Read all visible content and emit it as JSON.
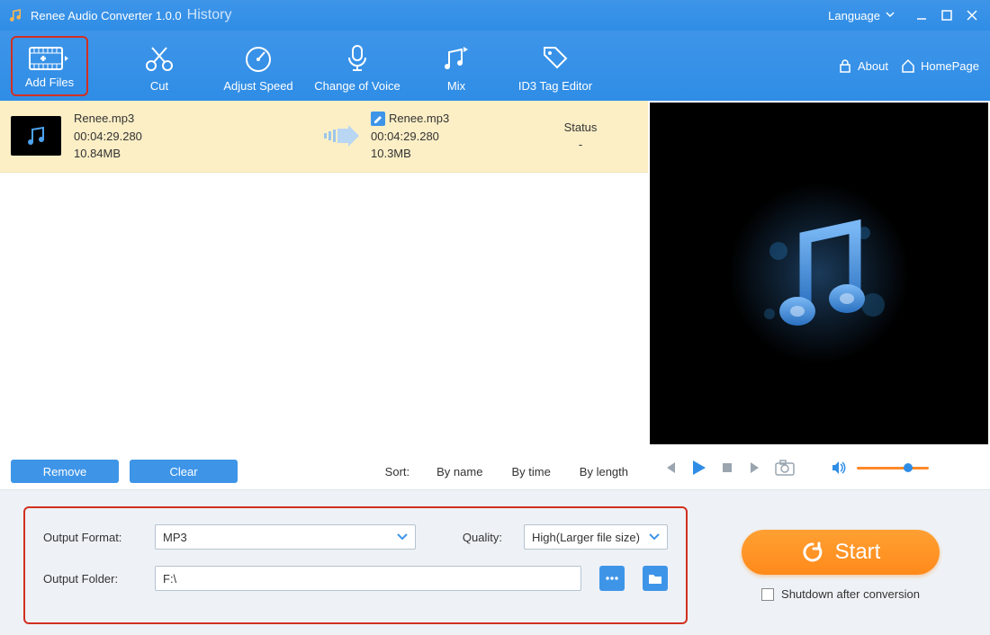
{
  "titlebar": {
    "title": "Renee Audio Converter 1.0.0",
    "history": "History",
    "language": "Language"
  },
  "toolbar": {
    "add_files": "Add Files",
    "cut": "Cut",
    "adjust_speed": "Adjust Speed",
    "change_voice": "Change of Voice",
    "mix": "Mix",
    "id3_editor": "ID3 Tag Editor",
    "about": "About",
    "homepage": "HomePage"
  },
  "file": {
    "src_name": "Renee.mp3",
    "src_duration": "00:04:29.280",
    "src_size": "10.84MB",
    "dst_name": "Renee.mp3",
    "dst_duration": "00:04:29.280",
    "dst_size": "10.3MB",
    "status_label": "Status",
    "status_value": "-"
  },
  "listactions": {
    "remove": "Remove",
    "clear": "Clear",
    "sort_label": "Sort:",
    "by_name": "By name",
    "by_time": "By time",
    "by_length": "By length"
  },
  "settings": {
    "output_format_label": "Output Format:",
    "output_format_value": "MP3",
    "quality_label": "Quality:",
    "quality_value": "High(Larger file size)",
    "output_folder_label": "Output Folder:",
    "output_folder_value": "F:\\"
  },
  "start": {
    "button": "Start",
    "shutdown": "Shutdown after conversion"
  }
}
